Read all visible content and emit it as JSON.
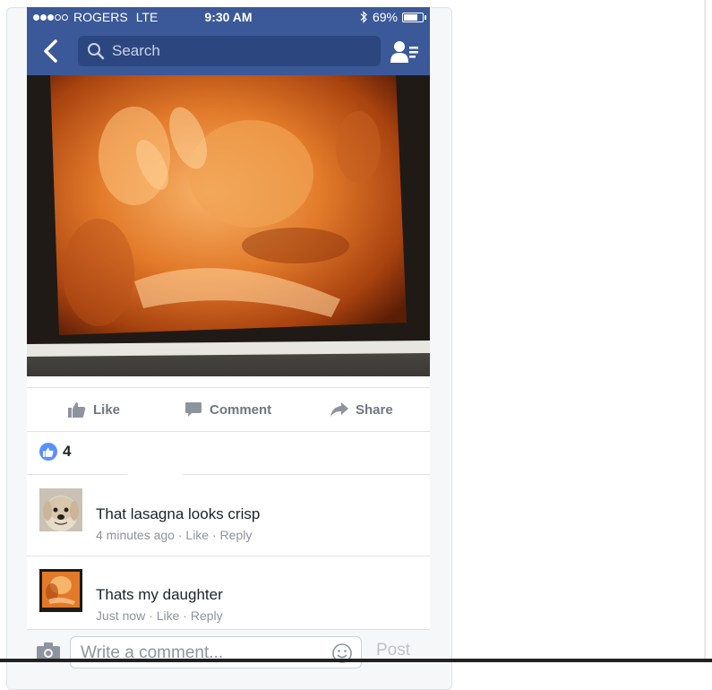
{
  "status_bar": {
    "carrier": "ROGERS",
    "network": "LTE",
    "time": "9:30 AM",
    "battery": "69%",
    "battery_level": 0.69
  },
  "nav": {
    "search_placeholder": "Search"
  },
  "actions": {
    "like": "Like",
    "comment": "Comment",
    "share": "Share"
  },
  "likes": {
    "count": "4"
  },
  "comments": [
    {
      "text": "That lasagna looks crisp",
      "time": "4 minutes ago",
      "like": "Like",
      "reply": "Reply"
    },
    {
      "text": "Thats my daughter",
      "time": "Just now",
      "like": "Like",
      "reply": "Reply"
    }
  ],
  "composer": {
    "placeholder": "Write a comment...",
    "post": "Post"
  },
  "colors": {
    "brand": "#3b5998",
    "like_badge": "#5890ff",
    "muted": "#90949c"
  },
  "icons": [
    "back-arrow-icon",
    "search-icon",
    "friend-requests-icon",
    "thumbs-up-icon",
    "comment-bubble-icon",
    "share-arrow-icon",
    "camera-icon",
    "smiley-icon"
  ]
}
